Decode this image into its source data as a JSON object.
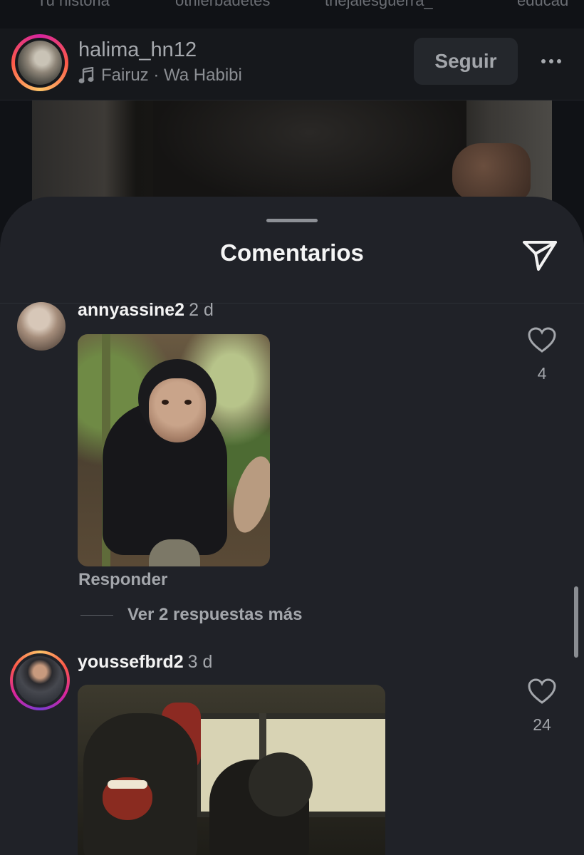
{
  "stories_strip": [
    "Tu historia",
    "othlerbadetes",
    "thejalesguerra_",
    "educad"
  ],
  "post": {
    "username": "halima_hn12",
    "music_icon": "music-note-icon",
    "music": "Fairuz · Wa Habibi",
    "follow_label": "Seguir",
    "more_icon": "more-horizontal-icon"
  },
  "sheet": {
    "title": "Comentarios",
    "share_icon": "send-icon"
  },
  "comments": [
    {
      "username": "annyassine2",
      "time": "2 d",
      "likes": "4",
      "reply_label": "Responder",
      "view_replies_label": "Ver 2 respuestas más"
    },
    {
      "username": "youssefbrd2",
      "time": "3 d",
      "likes": "24"
    }
  ],
  "colors": {
    "background": "#101216",
    "sheet": "#202228",
    "story_ring_start": "#d6249f",
    "story_ring_end": "#fdc468",
    "muted_text": "#a3a6ab"
  }
}
